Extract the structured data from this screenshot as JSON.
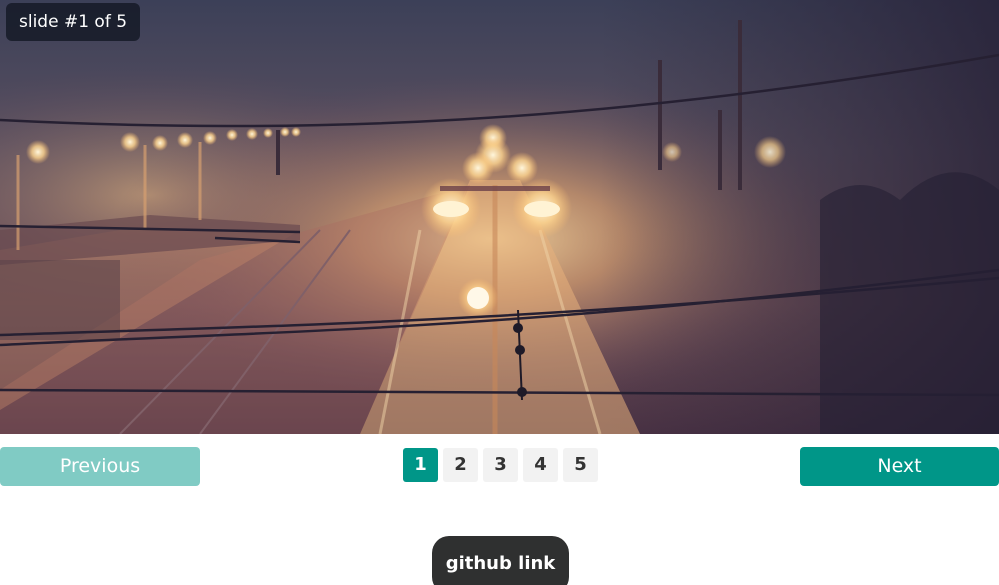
{
  "slider": {
    "counter_text": "slide #1 of 5",
    "image_icon": "foggy-train-station-photo",
    "current_page": 1
  },
  "controls": {
    "previous_label": "Previous",
    "next_label": "Next",
    "pages": [
      "1",
      "2",
      "3",
      "4",
      "5"
    ]
  },
  "footer": {
    "github_label": "github link"
  },
  "colors": {
    "accent": "#009688",
    "accent_disabled": "#80cbc4",
    "page_inactive_bg": "#f2f2f2",
    "github_bg": "#2f3030"
  }
}
